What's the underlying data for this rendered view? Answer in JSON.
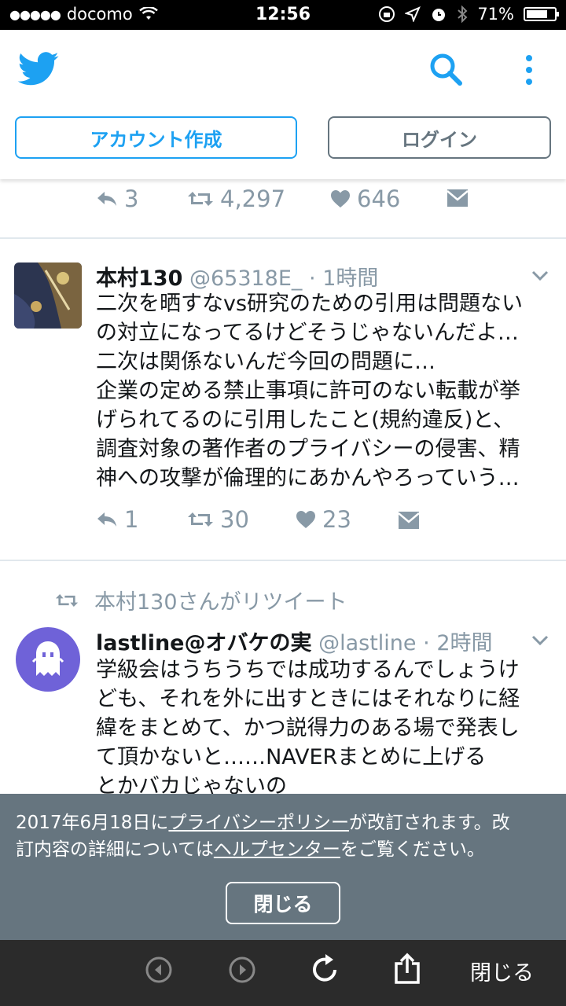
{
  "status": {
    "carrier": "docomo",
    "time": "12:56",
    "battery": "71%",
    "battery_level": 0.71
  },
  "header": {
    "logo": "twitter-bird-icon",
    "search_icon": "search-icon",
    "more_icon": "more-vertical-icon",
    "signup_label": "アカウント作成",
    "login_label": "ログイン",
    "accent_color": "#1da1f2"
  },
  "prev_tweet": {
    "replies": "3",
    "retweets": "4,297",
    "likes": "646"
  },
  "tweet1": {
    "name": "本村130",
    "handle": "@65318E_",
    "sep": "·",
    "time": "1時間",
    "lines": [
      "二次を晒すなvs研究のための引用は問題ない",
      "の対立になってるけどそうじゃないんだよ…",
      "二次は関係ないんだ今回の問題に…",
      "企業の定める禁止事項に許可のない転載が挙",
      "げられてるのに引用したこと(規約違反)と、",
      "調査対象の著作者のプライバシーの侵害、精",
      "神への攻撃が倫理的にあかんやろっていう…"
    ],
    "replies": "1",
    "retweets": "30",
    "likes": "23"
  },
  "tweet2": {
    "retweeted_by": "本村130さんがリツイート",
    "name": "lastline@オバケの実",
    "handle": "@lastline",
    "sep": "·",
    "time": "2時間",
    "lines": [
      "学級会はうちうちでは成功するんでしょうけ",
      "ども、それを外に出すときにはそれなりに経",
      "緯をまとめて、かつ説得力のある場で発表し",
      "て頂かないと‥‥‥NAVERまとめに上げる",
      "とかバカじゃないの"
    ]
  },
  "notice": {
    "text_a": "2017年6月18日に",
    "link1": "プライバシーポリシー",
    "text_b": "が改訂されます。改",
    "text_c": "訂内容の詳細については",
    "link2": "ヘルプセンター",
    "text_d": "をご覧ください。",
    "close_label": "閉じる"
  },
  "browser": {
    "close_label": "閉じる"
  }
}
